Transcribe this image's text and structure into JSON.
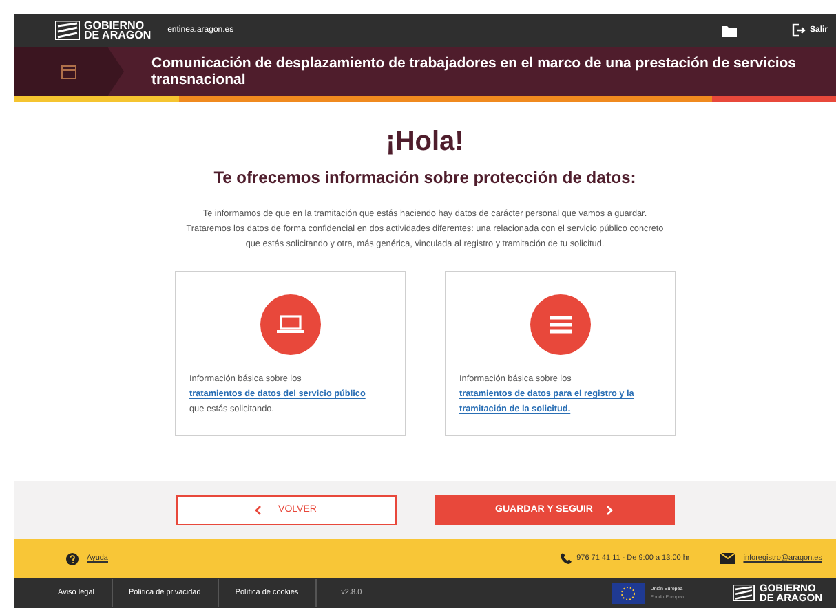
{
  "header": {
    "logo": [
      "GOBIERNO",
      "DE ARAGON"
    ],
    "site": "entinea.aragon.es",
    "exit": "Salir"
  },
  "procedure": {
    "title": "Comunicación de desplazamiento de trabajadores en el marco de una prestación de servicios transnacional"
  },
  "greeting": "¡Hola!",
  "subtitle": "Te ofrecemos información sobre protección de datos:",
  "intro": "Te informamos de que en la tramitación que estás haciendo hay datos de carácter personal que vamos a guardar. Trataremos los datos de forma confidencial en dos actividades diferentes: una relacionada con el servicio público concreto que estás solicitando y otra, más genérica, vinculada al registro y tramitación de tu solicitud.",
  "cards": [
    {
      "kind": "laptop",
      "before": "Información básica sobre los ",
      "link": "tratamientos de datos del servicio público",
      "after": " que estás solicitando."
    },
    {
      "kind": "menu",
      "before": "Información básica sobre los ",
      "link": "tratamientos de datos para el registro y la tramitación de la solicitud."
    }
  ],
  "buttons": {
    "back": "VOLVER",
    "next": "GUARDAR Y SEGUIR"
  },
  "help_bar": {
    "help": "Ayuda",
    "phone": "976 71 41 11 - De 9:00 a 13:00 hr",
    "email": "inforegistro@aragon.es"
  },
  "footer": {
    "links": [
      "Aviso legal",
      "Política de privacidad",
      "Política de cookies"
    ],
    "version": "v2.8.0",
    "eu": [
      "Unión Europea",
      "Fondo Europeo"
    ],
    "logo": [
      "GOBIERNO",
      "DE ARAGON"
    ]
  }
}
